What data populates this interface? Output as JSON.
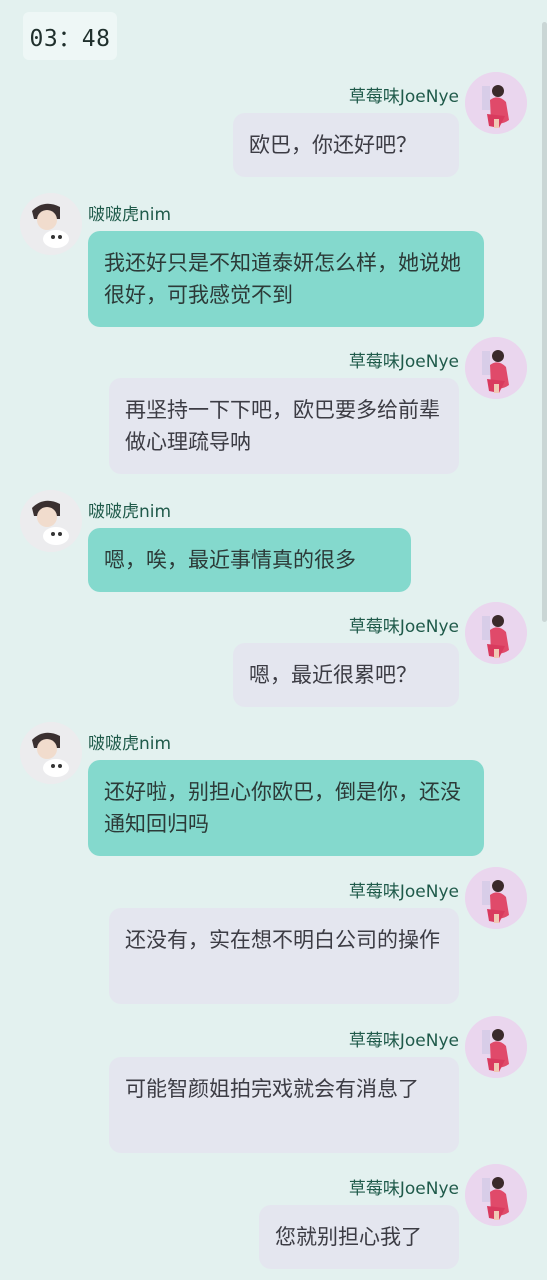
{
  "timestamp": "03：48",
  "messages": [
    {
      "sender": "草莓味JoeNye",
      "side": "right",
      "text": "欧巴，你还好吧？"
    },
    {
      "sender": "啵啵虎nim",
      "side": "left",
      "text": "我还好只是不知道泰妍怎么样，她说她很好，可我感觉不到"
    },
    {
      "sender": "草莓味JoeNye",
      "side": "right",
      "text": "再坚持一下下吧，欧巴要多给前辈做心理疏导呐"
    },
    {
      "sender": "啵啵虎nim",
      "side": "left",
      "text": "嗯，唉，最近事情真的很多"
    },
    {
      "sender": "草莓味JoeNye",
      "side": "right",
      "text": "嗯，最近很累吧？"
    },
    {
      "sender": "啵啵虎nim",
      "side": "left",
      "text": "还好啦，别担心你欧巴，倒是你，还没通知回归吗"
    },
    {
      "sender": "草莓味JoeNye",
      "side": "right",
      "text": "还没有，实在想不明白公司的操作"
    },
    {
      "sender": "草莓味JoeNye",
      "side": "right",
      "text": "可能智颜姐拍完戏就会有消息了"
    },
    {
      "sender": "草莓味JoeNye",
      "side": "right",
      "text": "您就别担心我了"
    }
  ]
}
